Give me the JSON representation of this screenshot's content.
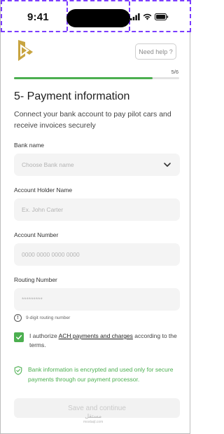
{
  "status_bar": {
    "time": "9:41"
  },
  "header": {
    "help_label": "Need help ?"
  },
  "progress": {
    "label": "5/6",
    "fraction": 0.84,
    "color": "#4caf50"
  },
  "page": {
    "title": "5- Payment information",
    "subtitle": "Connect your bank account to pay pilot cars and receive invoices securely"
  },
  "form": {
    "bank_name": {
      "label": "Bank name",
      "placeholder": "Choose Bank name"
    },
    "holder_name": {
      "label": "Account Holder Name",
      "placeholder": "Ex. John Carter"
    },
    "account_number": {
      "label": "Account Number",
      "placeholder": "0000 0000 0000 0000"
    },
    "routing_number": {
      "label": "Routing Number",
      "placeholder": "*********",
      "hint": "9-digit routing number"
    }
  },
  "authorization": {
    "checked": true,
    "prefix": "I authorize ",
    "link": "ACH payments and charges",
    "suffix": " according to the terms."
  },
  "security_note": "Bank information is encrypted and used only for secure payments through our payment processor.",
  "cta": {
    "label": "Save and continue"
  },
  "watermark": {
    "line1": "مستقل",
    "line2": "mostaql.com"
  },
  "colors": {
    "accent": "#4caf50",
    "logo": "#c8a440",
    "field_bg": "#f4f4f4"
  }
}
